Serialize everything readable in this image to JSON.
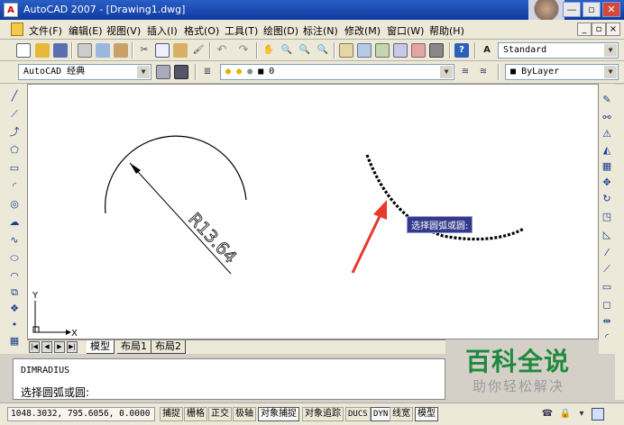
{
  "window": {
    "title": "AutoCAD 2007 - [Drawing1.dwg]",
    "app_icon": "autocad-icon",
    "controls": {
      "minimize": "—",
      "restore": "▫",
      "close": "✕"
    }
  },
  "menu": {
    "items": [
      "文件(F)",
      "编辑(E)",
      "视图(V)",
      "插入(I)",
      "格式(O)",
      "工具(T)",
      "绘图(D)",
      "标注(N)",
      "修改(M)",
      "窗口(W)",
      "帮助(H)"
    ],
    "doc_controls": {
      "minimize": "_",
      "restore": "▫",
      "close": "×"
    }
  },
  "toolbar_standard": {
    "icons": [
      "new-icon",
      "open-icon",
      "save-icon",
      "print-icon",
      "preview-icon",
      "publish-icon",
      "cut-icon",
      "copy-icon",
      "paste-icon",
      "matchprop-icon",
      "undo-icon",
      "redo-icon",
      "pan-icon",
      "zoom-realtime-icon",
      "zoom-window-icon",
      "zoom-previous-icon",
      "properties-icon",
      "designcenter-icon",
      "toolpalettes-icon",
      "sheetset-icon",
      "markup-icon",
      "calculator-icon",
      "help-icon",
      "textstyle-icon"
    ],
    "text_style": "Standard"
  },
  "toolbar_workspace": {
    "workspace": "AutoCAD 经典",
    "layer": "0",
    "color": "ByLayer"
  },
  "canvas": {
    "dimension_text": "R13.64",
    "tooltip": "选择圆弧或圆:"
  },
  "ucs": {
    "x_label": "X",
    "y_label": "Y"
  },
  "layout_tabs": [
    "模型",
    "布局1",
    "布局2"
  ],
  "layout_nav": [
    "|◀",
    "◀",
    "▶",
    "▶|"
  ],
  "command": {
    "history": "DIMRADIUS",
    "prompt": "选择圆弧或圆:"
  },
  "watermark": {
    "title": "百科全说",
    "subtitle": "助你轻松解决"
  },
  "status": {
    "coords": "1048.3032, 795.6056, 0.0000",
    "toggles": [
      {
        "label": "捕捉",
        "on": false
      },
      {
        "label": "栅格",
        "on": false
      },
      {
        "label": "正交",
        "on": false
      },
      {
        "label": "极轴",
        "on": false
      },
      {
        "label": "对象捕捉",
        "on": true
      },
      {
        "label": "对象追踪",
        "on": false
      },
      {
        "label": "DUCS",
        "on": false
      },
      {
        "label": "DYN",
        "on": true
      },
      {
        "label": "线宽",
        "on": false
      },
      {
        "label": "模型",
        "on": true
      }
    ]
  },
  "right_toolbar": {
    "icons": [
      "erase-icon",
      "copy-object-icon",
      "mirror-icon",
      "offset-icon",
      "array-icon",
      "move-icon",
      "rotate-icon",
      "scale-icon",
      "stretch-icon",
      "trim-icon",
      "extend-icon",
      "break-icon",
      "join-icon",
      "chamfer-icon",
      "fillet-icon",
      "explode-icon"
    ]
  },
  "left_toolbar": {
    "icons": [
      "line-icon",
      "construction-line-icon",
      "polyline-icon",
      "polygon-icon",
      "rectangle-icon",
      "arc-icon",
      "circle-icon",
      "revision-cloud-icon",
      "spline-icon",
      "ellipse-icon",
      "ellipse-arc-icon",
      "insert-block-icon",
      "make-block-icon",
      "point-icon",
      "hatch-icon"
    ]
  }
}
